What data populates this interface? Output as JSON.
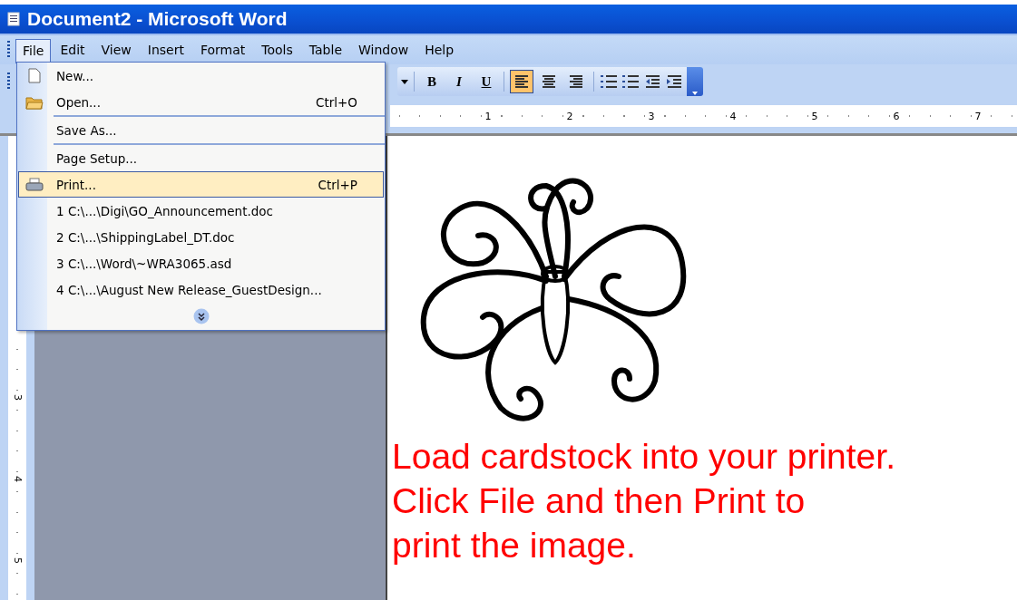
{
  "window": {
    "title": "Document2 - Microsoft Word"
  },
  "menu_bar": [
    {
      "label": "File",
      "selected": true
    },
    {
      "label": "Edit",
      "selected": false
    },
    {
      "label": "View",
      "selected": false
    },
    {
      "label": "Insert",
      "selected": false
    },
    {
      "label": "Format",
      "selected": false
    },
    {
      "label": "Tools",
      "selected": false
    },
    {
      "label": "Table",
      "selected": false
    },
    {
      "label": "Window",
      "selected": false
    },
    {
      "label": "Help",
      "selected": false
    }
  ],
  "toolbar": [
    {
      "kind": "dropdown"
    },
    {
      "kind": "bold",
      "label": "B"
    },
    {
      "kind": "italic",
      "label": "I"
    },
    {
      "kind": "underline",
      "label": "U"
    },
    {
      "kind": "align_left",
      "selected": true
    },
    {
      "kind": "align_center",
      "selected": false
    },
    {
      "kind": "align_right",
      "selected": false
    },
    {
      "kind": "numbering"
    },
    {
      "kind": "bullets"
    },
    {
      "kind": "outdent"
    },
    {
      "kind": "indent"
    },
    {
      "kind": "options"
    }
  ],
  "ruler": {
    "marks": [
      "1",
      "2",
      "3",
      "4",
      "5",
      "6",
      "7"
    ]
  },
  "vertical_ruler": {
    "marks": [
      "3",
      "4",
      "5"
    ]
  },
  "file_menu": {
    "items": [
      {
        "kind": "document",
        "label": "New...",
        "selected": false
      },
      {
        "kind": "folder",
        "label": "Open...",
        "shortcut": "Ctrl+O",
        "selected": false
      },
      {
        "kind": "separator"
      },
      {
        "kind": "plain",
        "label": "Save As...",
        "selected": false
      },
      {
        "kind": "separator"
      },
      {
        "kind": "plain",
        "label": "Page Setup...",
        "selected": false
      },
      {
        "kind": "printer",
        "label": "Print...",
        "shortcut": "Ctrl+P",
        "selected": true
      },
      {
        "kind": "plain",
        "label": "1 C:\\...\\Digi\\GO_Announcement.doc",
        "selected": false
      },
      {
        "kind": "plain",
        "label": "2 C:\\...\\ShippingLabel_DT.doc",
        "selected": false
      },
      {
        "kind": "plain",
        "label": "3 C:\\...\\Word\\~WRA3065.asd",
        "selected": false
      },
      {
        "kind": "plain",
        "label": "4 C:\\...\\August New Release_GuestDesign...",
        "selected": false
      },
      {
        "kind": "expand"
      }
    ]
  },
  "document": {
    "lines": [
      "Load cardstock into your printer.",
      "Click File and then Print to",
      "print the image."
    ]
  }
}
